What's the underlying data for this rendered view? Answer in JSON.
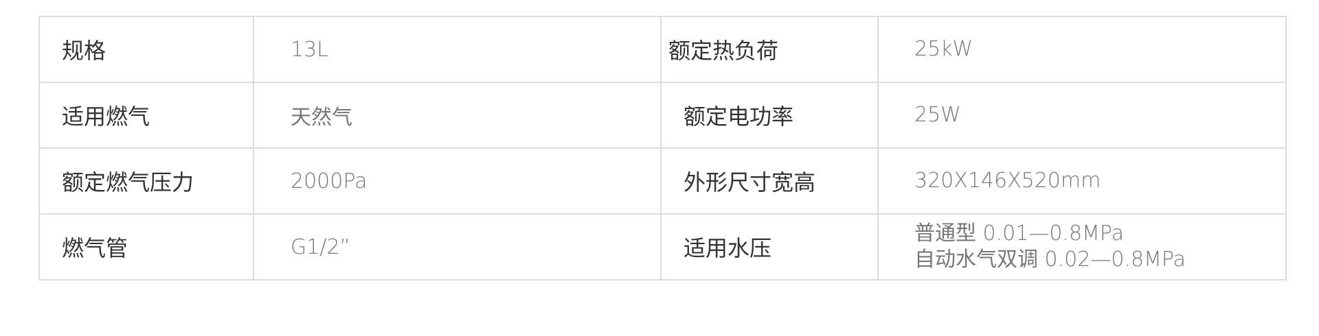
{
  "spec_table": {
    "rows": [
      {
        "label_left": "规格",
        "value_left": "13L",
        "label_right": "额定热负荷",
        "value_right": [
          "25kW"
        ]
      },
      {
        "label_left": "适用燃气",
        "value_left": "天然气",
        "label_right": "额定电功率",
        "value_right": [
          "25W"
        ]
      },
      {
        "label_left": "额定燃气压力",
        "value_left": "2000Pa",
        "label_right": "外形尺寸宽高",
        "value_right": [
          "320X146X520mm"
        ]
      },
      {
        "label_left": "燃气管",
        "value_left": "G1/2”",
        "label_right": "适用水压",
        "value_right": [
          "普通型 0.01—0.8MPa",
          "自动水气双调 0.02—0.8MPa"
        ]
      }
    ]
  }
}
